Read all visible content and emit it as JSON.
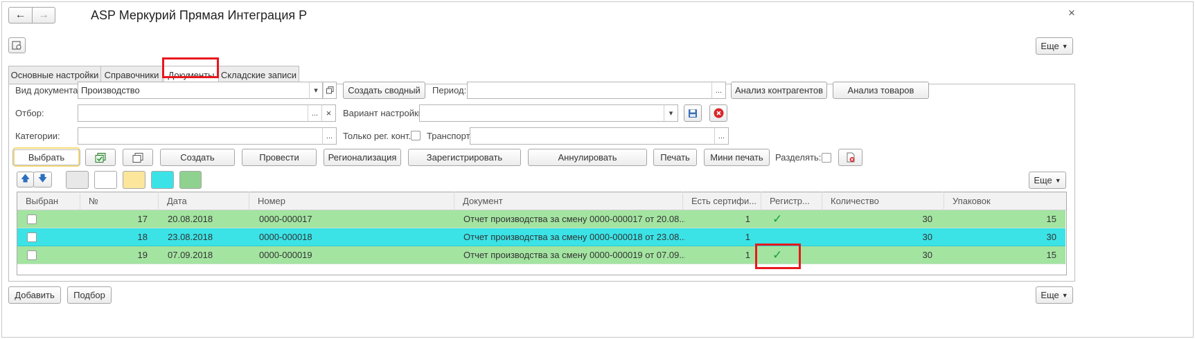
{
  "window": {
    "title": "ASP Меркурий Прямая Интеграция Р",
    "back_icon": "←",
    "forward_icon": "→",
    "close_icon": "×"
  },
  "toolbar": {
    "more_label": "Еще"
  },
  "tabs": [
    {
      "label": "Основные настройки"
    },
    {
      "label": "Справочники"
    },
    {
      "label": "Документы"
    },
    {
      "label": "Складские записи"
    }
  ],
  "filters": {
    "doc_type_label": "Вид документа:",
    "doc_type_value": "Производство",
    "create_summary_label": "Создать сводный",
    "period_label": "Период:",
    "period_value": "",
    "analyze_counterparties_label": "Анализ контрагентов",
    "analyze_goods_label": "Анализ товаров",
    "filter_label": "Отбор:",
    "filter_value": "",
    "variant_label": "Вариант настройки:",
    "variant_value": "",
    "categories_label": "Категории:",
    "categories_value": "",
    "only_reg_label": "Только рег. конт.:",
    "transport_label": "Транспорт:",
    "transport_value": "",
    "ellipsis": "...",
    "clear": "×",
    "dropdown": "▾"
  },
  "actions": {
    "select_label": "Выбрать",
    "create_label": "Создать",
    "post_label": "Провести",
    "regionalize_label": "Регионализация",
    "register_label": "Зарегистрировать",
    "cancel_label": "Аннулировать",
    "print_label": "Печать",
    "mini_print_label": "Мини печать",
    "split_label": "Разделять:"
  },
  "colors": {
    "green_row": "#a3e4a1",
    "cyan_row": "#3be3e6",
    "swatch_gray": "#e8e8e8",
    "swatch_white": "#ffffff",
    "swatch_yellow": "#fbe69c",
    "swatch_cyan": "#3be3e6",
    "swatch_green": "#8fd18f"
  },
  "table": {
    "columns": [
      "Выбран",
      "№",
      "Дата",
      "Номер",
      "Документ",
      "Есть сертифи...",
      "Регистр...",
      "Количество",
      "Упаковок"
    ],
    "rows": [
      {
        "n": "17",
        "date": "20.08.2018",
        "number": "0000-000017",
        "doc": "Отчет производства за смену 0000-000017 от 20.08....",
        "cert": "1",
        "reg": "✓",
        "qty": "30",
        "packs": "15",
        "color": "green"
      },
      {
        "n": "18",
        "date": "23.08.2018",
        "number": "0000-000018",
        "doc": "Отчет производства за смену 0000-000018 от 23.08....",
        "cert": "1",
        "reg": "",
        "qty": "30",
        "packs": "30",
        "color": "cyan"
      },
      {
        "n": "19",
        "date": "07.09.2018",
        "number": "0000-000019",
        "doc": "Отчет производства за смену 0000-000019 от 07.09....",
        "cert": "1",
        "reg": "✓",
        "qty": "30",
        "packs": "15",
        "color": "green"
      }
    ]
  },
  "footer": {
    "add_label": "Добавить",
    "pick_label": "Подбор"
  }
}
